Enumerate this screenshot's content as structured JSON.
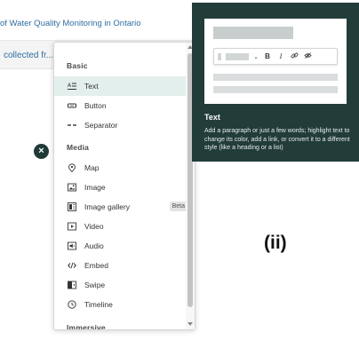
{
  "story": {
    "title": "of Water Quality Monitoring in Ontario",
    "snippet": "collected fr..."
  },
  "menu": {
    "sections": [
      {
        "label": "Basic",
        "items": [
          {
            "label": "Text",
            "icon": "text-icon"
          },
          {
            "label": "Button",
            "icon": "button-icon"
          },
          {
            "label": "Separator",
            "icon": "separator-icon"
          }
        ]
      },
      {
        "label": "Media",
        "items": [
          {
            "label": "Map",
            "icon": "map-pin-icon"
          },
          {
            "label": "Image",
            "icon": "image-icon"
          },
          {
            "label": "Image gallery",
            "icon": "image-gallery-icon",
            "badge": "Beta"
          },
          {
            "label": "Video",
            "icon": "video-icon"
          },
          {
            "label": "Audio",
            "icon": "audio-icon"
          },
          {
            "label": "Embed",
            "icon": "embed-icon"
          },
          {
            "label": "Swipe",
            "icon": "swipe-icon"
          },
          {
            "label": "Timeline",
            "icon": "timeline-icon"
          }
        ]
      },
      {
        "label": "Immersive",
        "items": []
      }
    ],
    "active_item": "Text"
  },
  "tooltip": {
    "title": "Text",
    "description": "Add a paragraph or just a few words; highlight text to change its color, add a link, or convert it to a different style (like a heading or a list)",
    "toolbar": {
      "caret": "⌄",
      "bold": "B",
      "italic": "I"
    }
  },
  "close_button": {
    "glyph": "×"
  },
  "caption": "(ii)",
  "colors": {
    "accent": "#223c39",
    "active_row": "#e3efec",
    "link": "#2f6fa3"
  }
}
